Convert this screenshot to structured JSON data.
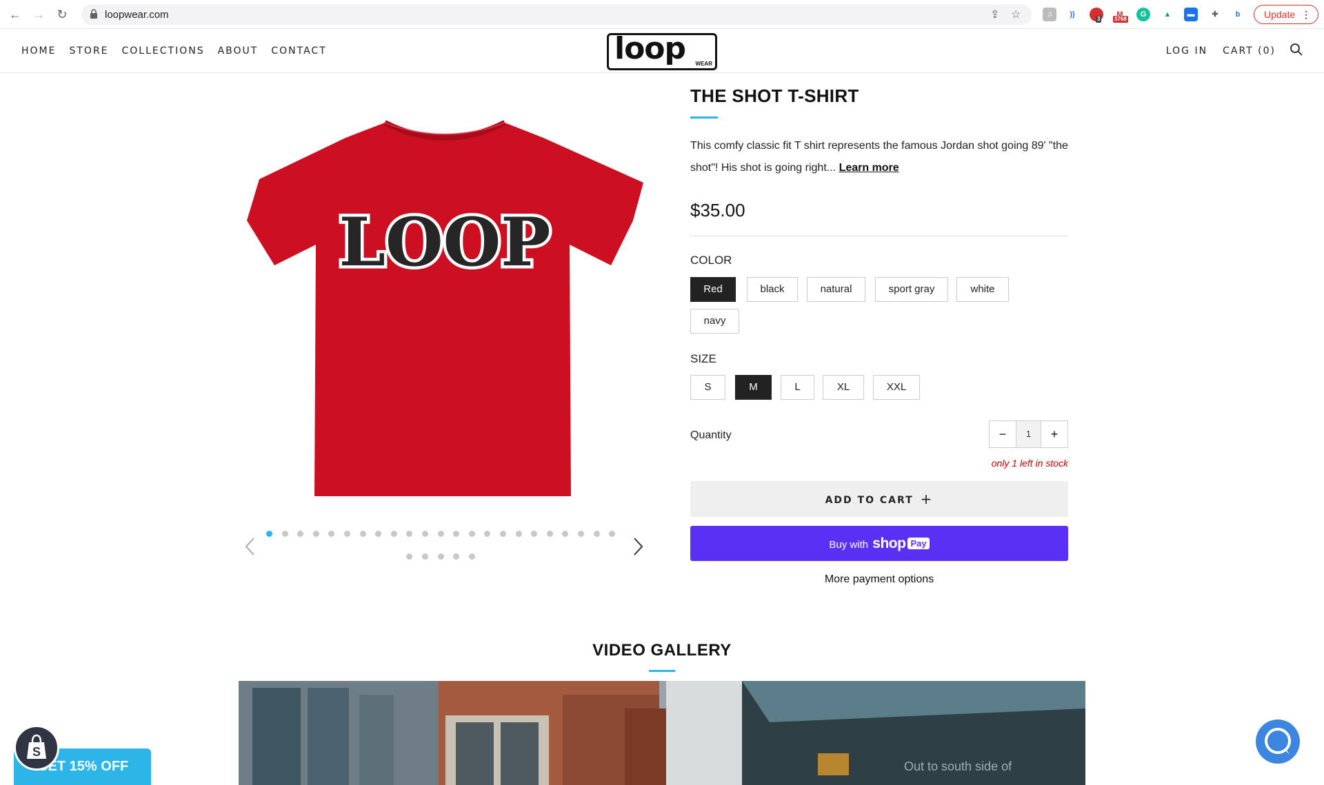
{
  "browser": {
    "url": "loopwear.com",
    "update_label": "Update",
    "ext_badges": [
      "3",
      "3768"
    ]
  },
  "header": {
    "nav": [
      "HOME",
      "STORE",
      "COLLECTIONS",
      "ABOUT",
      "CONTACT"
    ],
    "logo_text": "loop",
    "logo_sub": "WEAR",
    "login": "LOG IN",
    "cart": "CART (0)"
  },
  "product": {
    "title": "THE SHOT T-SHIRT",
    "description": "This comfy classic fit T shirt represents the famous Jordan shot going 89' \"the shot\"! His shot is going right...",
    "learn_more": "Learn more",
    "price": "$35.00",
    "image_text": "LOOP",
    "color_label": "COLOR",
    "colors": [
      "Red",
      "black",
      "natural",
      "sport gray",
      "white",
      "navy"
    ],
    "selected_color": "Red",
    "size_label": "SIZE",
    "sizes": [
      "S",
      "M",
      "L",
      "XL",
      "XXL"
    ],
    "selected_size": "M",
    "quantity_label": "Quantity",
    "quantity": "1",
    "qty_minus": "−",
    "qty_plus": "+",
    "stock_note": "only 1 left in stock",
    "add_to_cart": "ADD TO CART",
    "buy_with": "Buy with",
    "shop": "shop",
    "pay": "Pay",
    "more_payment": "More payment options",
    "slide_count": 28,
    "active_slide": 1
  },
  "gallery": {
    "title": "VIDEO GALLERY",
    "video_caption": "Out to south side of"
  },
  "widgets": {
    "discount": "GET 15% OFF"
  },
  "colors": {
    "accent": "#2db5e8",
    "shirt_red": "#cc1022",
    "shop_pay": "#5a31f4",
    "stock_red": "#cc0000"
  }
}
